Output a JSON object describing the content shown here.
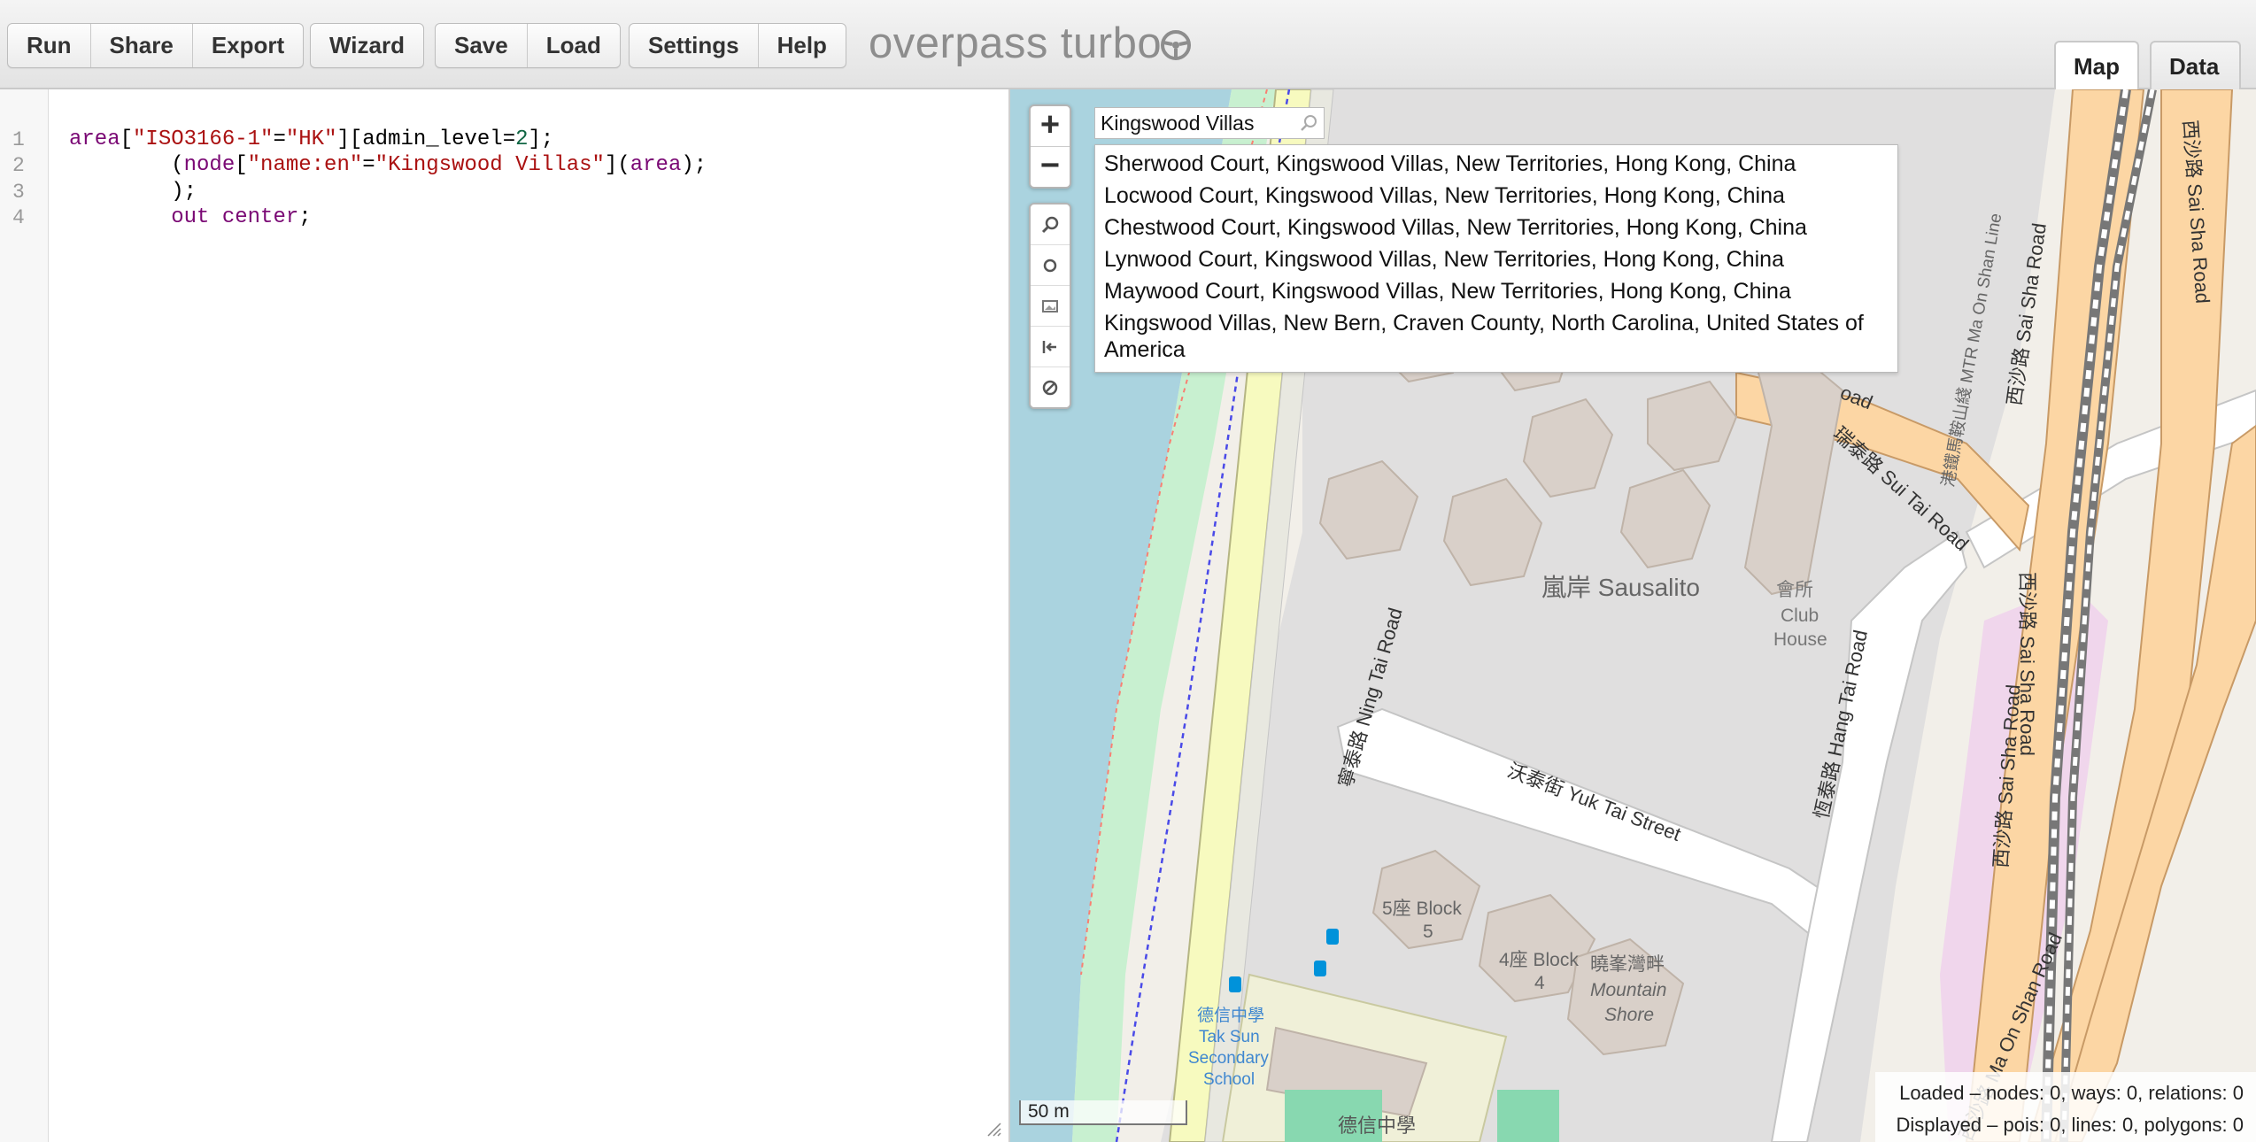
{
  "toolbar": {
    "buttons": {
      "run": "Run",
      "share": "Share",
      "export": "Export",
      "wizard": "Wizard",
      "save": "Save",
      "load": "Load",
      "settings": "Settings",
      "help": "Help"
    },
    "app_title": "overpass turbo",
    "logo_icon": "steering-wheel-icon"
  },
  "view_tabs": {
    "map": "Map",
    "data": "Data",
    "active": "map"
  },
  "editor": {
    "line_numbers": [
      "1",
      "2",
      "3",
      "4"
    ],
    "lines": [
      "area[\"ISO3166-1\"=\"HK\"][admin_level=2];",
      "        (node[\"name:en\"=\"Kingswood Villas\"](area);",
      "        );",
      "        out center;"
    ]
  },
  "map": {
    "zoom_in": "+",
    "zoom_out": "−",
    "tools": [
      "zoom-to-data-icon",
      "current-location-icon",
      "export-image-icon",
      "fit-bounds-icon",
      "clear-icon"
    ],
    "search": {
      "value": "Kingswood Villas"
    },
    "suggestions": [
      "Sherwood Court, Kingswood Villas, New Territories, Hong Kong, China",
      "Locwood Court, Kingswood Villas, New Territories, Hong Kong, China",
      "Chestwood Court, Kingswood Villas, New Territories, Hong Kong, China",
      "Lynwood Court, Kingswood Villas, New Territories, Hong Kong, China",
      "Maywood Court, Kingswood Villas, New Territories, Hong Kong, China",
      "Kingswood Villas, New Bern, Craven County, North Carolina, United States of America"
    ],
    "labels": {
      "sausalito": "嵐岸 Sausalito",
      "club_house_cn": "會所",
      "club_house_1": "Club",
      "club_house_2": "House",
      "ning_tai_road": "寧泰路 Ning Tai Road",
      "yuk_tai_street": "沃泰街 Yuk Tai Street",
      "hang_tai_road": "恆泰路 Hang Tai Road",
      "sui_tai_road": "瑞泰路 Sui Tai Road",
      "sai_sha_road_1": "西沙路 Sai Sha Road",
      "sai_sha_road_2": "西沙路 Sai Sha Road",
      "sai_sha_road_3": "西沙路 Sai Sha Road",
      "sai_sha_road_4": "西沙路 Sai Sha Road",
      "ma_on_shan_road": "西沙路 Ma On Shan Road",
      "mtr_line": "港鐵馬鞍山綫 MTR Ma On Shan Line",
      "block5_1": "5座 Block",
      "block5_2": "5",
      "block4_1": "4座 Block",
      "block4_2": "4",
      "mountain_shore_cn": "曉峯灣畔",
      "mountain_shore_1": "Mountain",
      "mountain_shore_2": "Shore",
      "school_cn": "德信中學",
      "school_1": "Tak Sun",
      "school_2": "Secondary",
      "school_3": "School",
      "school_bottom": "德信中學",
      "road_fragment": "oad"
    },
    "scale": "50 m",
    "stats": {
      "loaded": "Loaded – nodes: 0, ways: 0, relations: 0",
      "displayed": "Displayed – pois: 0, lines: 0, polygons: 0"
    },
    "colors": {
      "water": "#aad3df",
      "road_primary": "#fcd6a4",
      "road_trunk": "#f9b29c",
      "residential": "#e0dfdf",
      "building": "#d9d0c9"
    }
  }
}
